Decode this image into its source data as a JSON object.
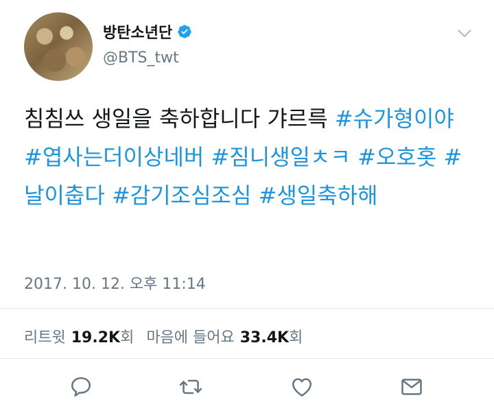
{
  "user": {
    "name": "방탄소년단",
    "handle": "@BTS_twt",
    "verified": true
  },
  "tweet": {
    "text": "침침쓰 생일을 축하합니다 갸르륵",
    "hashtags": [
      "#슈가형이야",
      "#엽사는더이상네버",
      "#짐니생일ㅊㅋ",
      "#오호홋",
      "#날이춥다",
      "#감기조심조심",
      "#생일축하해"
    ],
    "timestamp": "2017. 10. 12. 오후 11:14"
  },
  "stats": {
    "retweets_label": "리트윗",
    "retweets_count": "19.2K",
    "retweets_unit": "회",
    "likes_label": "마음에 들어요",
    "likes_count": "33.4K",
    "likes_unit": "회"
  },
  "colors": {
    "hashtag": "#1b95e0",
    "verified": "#1da1f2",
    "secondary_text": "#657786",
    "divider": "#e1e8ed"
  },
  "icons": [
    "chevron-down-icon",
    "verified-badge-icon",
    "reply-icon",
    "retweet-icon",
    "like-icon",
    "direct-message-icon"
  ]
}
